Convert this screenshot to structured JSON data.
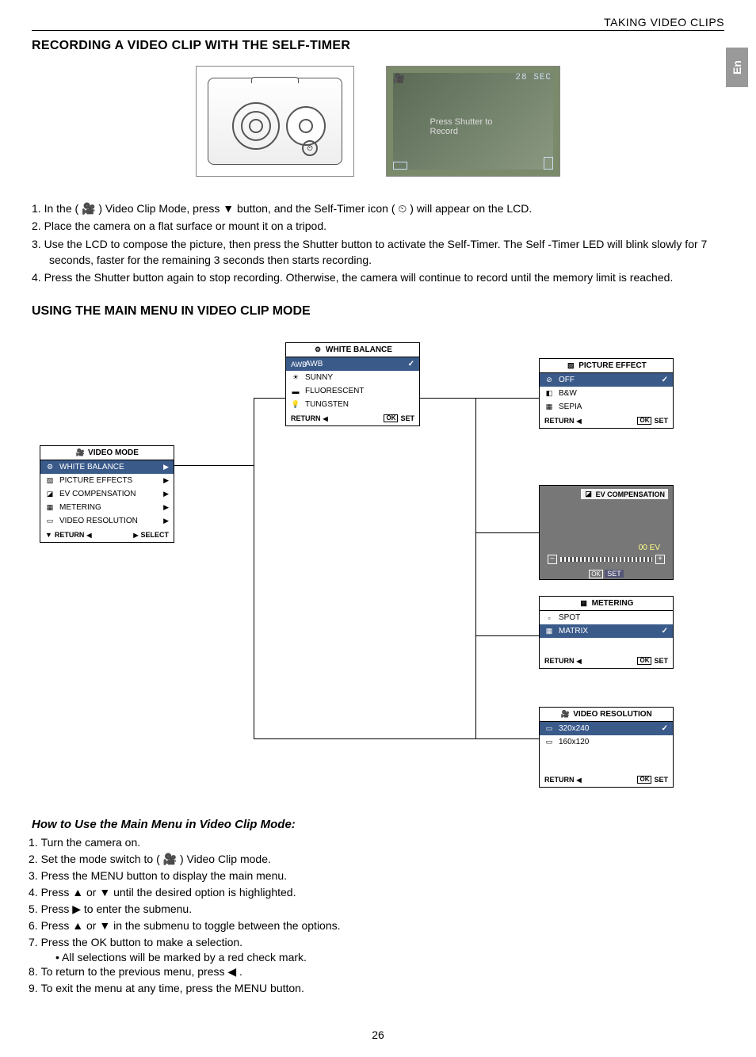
{
  "header": {
    "section_label": "TAKING VIDEO CLIPS",
    "lang_tab": "En"
  },
  "section1": {
    "title": "RECORDING A VIDEO CLIP WITH THE SELF-TIMER",
    "lcd": {
      "timer_text": "28 SEC",
      "hint": "Press Shutter to Record"
    },
    "steps": [
      "In the (  🎥  ) Video Clip Mode, press  ▼  button, and the Self-Timer icon (  ⏲  ) will appear on the LCD.",
      "Place the camera on a flat surface or mount it on a tripod.",
      "Use the LCD to compose the picture, then press the Shutter button to activate the Self-Timer. The Self -Timer LED will blink slowly for 7 seconds, faster for the remaining 3 seconds then starts recording.",
      "Press the Shutter button again to stop recording. Otherwise, the camera will continue to record until the memory limit is reached."
    ]
  },
  "section2": {
    "title": "USING THE MAIN MENU IN VIDEO CLIP MODE",
    "menus": {
      "video_mode": {
        "title": "VIDEO MODE",
        "items": [
          "WHITE BALANCE",
          "PICTURE EFFECTS",
          "EV COMPENSATION",
          "METERING",
          "VIDEO RESOLUTION"
        ],
        "footer_left": "RETURN",
        "footer_right": "SELECT"
      },
      "white_balance": {
        "title": "WHITE BALANCE",
        "items": [
          {
            "label": "AWB",
            "icon": "AWB",
            "selected": true
          },
          {
            "label": "SUNNY",
            "icon": "☀"
          },
          {
            "label": "FLUORESCENT",
            "icon": "▬"
          },
          {
            "label": "TUNGSTEN",
            "icon": "💡"
          }
        ],
        "footer_left": "RETURN",
        "footer_right": "SET"
      },
      "picture_effect": {
        "title": "PICTURE EFFECT",
        "items": [
          {
            "label": "OFF",
            "icon": "⊘",
            "selected": true
          },
          {
            "label": "B&W",
            "icon": "◧"
          },
          {
            "label": "SEPIA",
            "icon": "▦"
          }
        ],
        "footer_left": "RETURN",
        "footer_right": "SET"
      },
      "ev": {
        "title": "EV COMPENSATION",
        "value": "00 EV",
        "footer": "OK  SET"
      },
      "metering": {
        "title": "METERING",
        "items": [
          {
            "label": "SPOT",
            "icon": "▫"
          },
          {
            "label": "MATRIX",
            "icon": "▦",
            "selected": true
          }
        ],
        "footer_left": "RETURN",
        "footer_right": "SET"
      },
      "video_res": {
        "title": "VIDEO RESOLUTION",
        "items": [
          {
            "label": "320x240",
            "selected": true
          },
          {
            "label": "160x120"
          }
        ],
        "footer_left": "RETURN",
        "footer_right": "SET"
      }
    },
    "howto": {
      "title": "How to Use the Main Menu in Video Clip Mode:",
      "steps": [
        "Turn the camera on.",
        "Set the mode switch to (  🎥  ) Video Clip mode.",
        "Press the MENU button to display the main menu.",
        "Press  ▲  or  ▼  until the desired option is highlighted.",
        "Press  ▶  to enter the submenu.",
        "Press  ▲  or  ▼  in the submenu to toggle between the options.",
        "Press the OK button to make a selection."
      ],
      "bullet": "All selections will be marked by a red check mark.",
      "steps_cont": [
        "To return to the previous menu, press  ◀  .",
        "To exit the menu at any time, press the MENU button."
      ]
    }
  },
  "page_number": "26"
}
